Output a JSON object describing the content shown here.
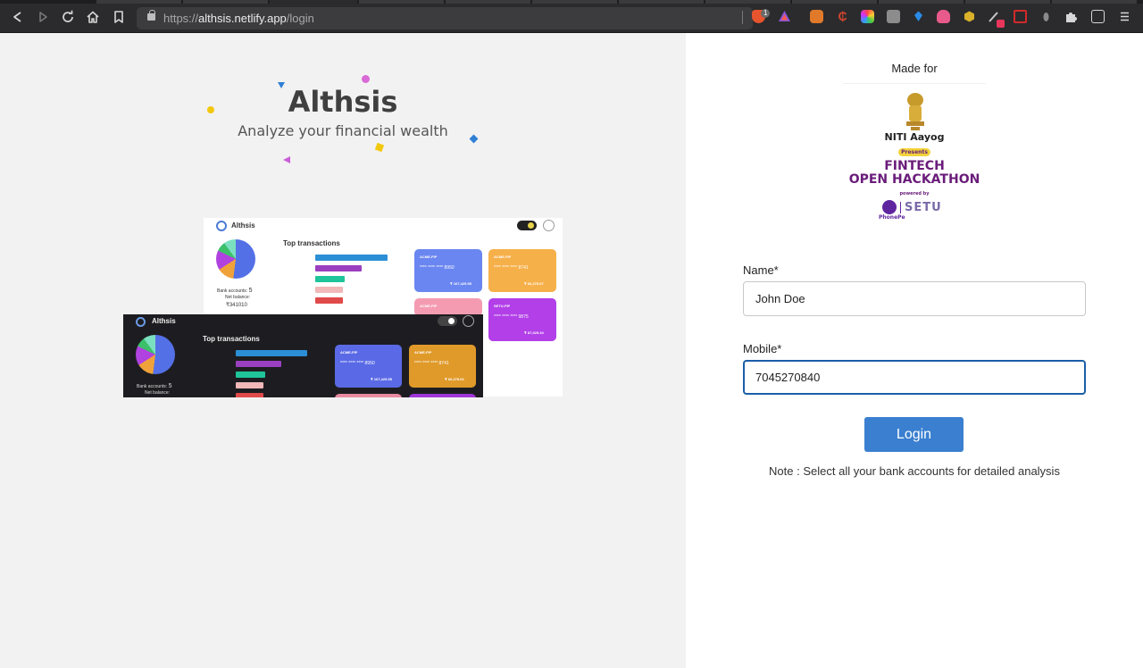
{
  "browser": {
    "url_scheme": "https://",
    "url_host": "althsis.netlify.app",
    "url_path": "/login",
    "shields_count": "1"
  },
  "hero": {
    "brand": "Althsis",
    "tagline": "Analyze your financial wealth"
  },
  "preview_light": {
    "app_name": "Althsis",
    "section_title": "Top transactions",
    "bank_accounts_label": "Bank accounts:",
    "bank_accounts_value": "5",
    "net_balance_label": "Net balance:",
    "net_balance_value": "₹341010",
    "cards": [
      {
        "title": "ACME-FIP",
        "number": "**** **** **** 8950",
        "amount": "₹ 167,425.55"
      },
      {
        "title": "ACME-FIP",
        "number": "**** **** **** 8741",
        "amount": "₹ 66,278.07"
      },
      {
        "title": "ACME-FIP",
        "number": "",
        "amount": ""
      },
      {
        "title": "SETU-FIP",
        "number": "**** **** **** 9875",
        "amount": "₹ 87,025.34"
      }
    ]
  },
  "preview_dark": {
    "app_name": "Althsis",
    "section_title": "Top transactions",
    "bank_accounts_label": "Bank accounts:",
    "bank_accounts_value": "5",
    "net_balance_label": "Net balance:",
    "cards": [
      {
        "title": "ACME-FIP",
        "number": "**** **** **** 8950",
        "amount": "₹ 167,425.55"
      },
      {
        "title": "ACME-FIP",
        "number": "**** **** **** 8741",
        "amount": "₹ 66,278.02"
      }
    ]
  },
  "login": {
    "made_for": "Made for",
    "hackathon_org": "NITI Aayog",
    "hackathon_presents": "Presents",
    "hackathon_line1": "FINTECH",
    "hackathon_line2": "OPEN HACKATHON",
    "hackathon_powered": "powered by",
    "sponsor_1": "PhonePe",
    "sponsor_2": "SETU",
    "name_label": "Name*",
    "name_value": "John Doe",
    "mobile_label": "Mobile*",
    "mobile_value": "7045270840",
    "login_button": "Login",
    "note": "Note : Select all your bank accounts for detailed analysis"
  },
  "colors": {
    "accent": "#3a7fd0",
    "focus_border": "#1a5ea8",
    "left_bg": "#f2f2f2",
    "right_bg": "#ffffff"
  }
}
